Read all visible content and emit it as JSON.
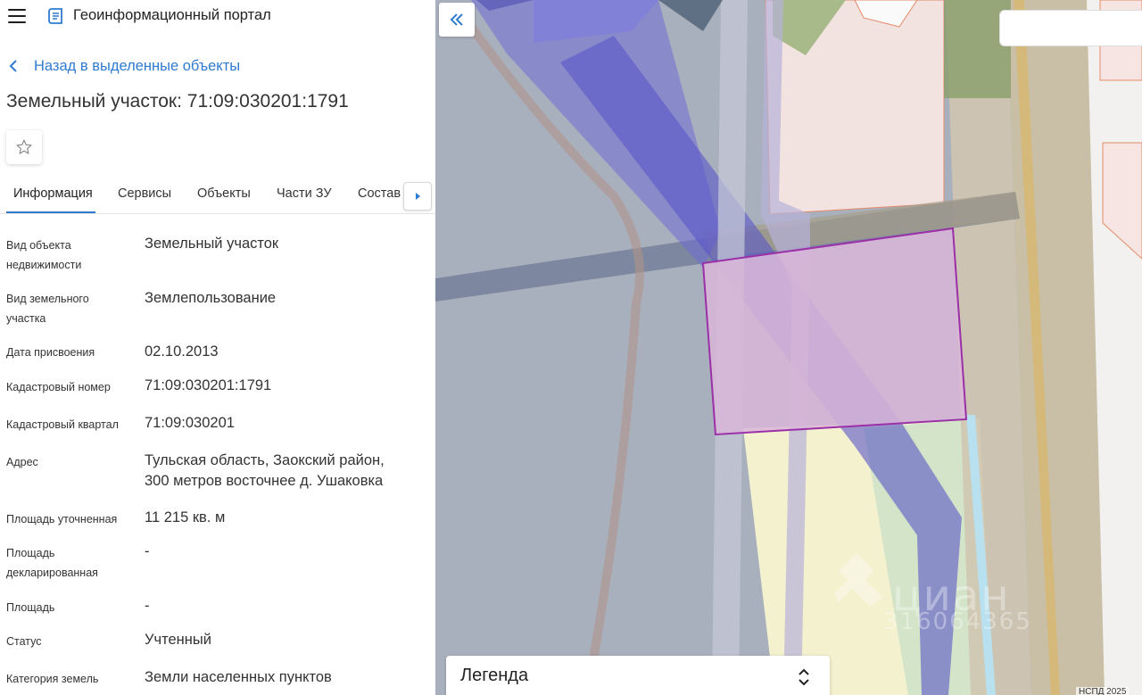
{
  "app": {
    "title": "Геоинформационный портал"
  },
  "nav": {
    "back_label": "Назад в выделенные объекты"
  },
  "object": {
    "title": "Земельный участок: 71:09:030201:1791"
  },
  "tabs": [
    {
      "label": "Информация",
      "active": true
    },
    {
      "label": "Сервисы"
    },
    {
      "label": "Объекты"
    },
    {
      "label": "Части ЗУ"
    },
    {
      "label": "Состав"
    }
  ],
  "info": [
    {
      "label": "Вид объекта недвижимости",
      "value": "Земельный участок"
    },
    {
      "label": "Вид земельного участка",
      "value": "Землепользование"
    },
    {
      "label": "Дата присвоения",
      "value": "02.10.2013"
    },
    {
      "label": "Кадастровый номер",
      "value": "71:09:030201:1791"
    },
    {
      "label": "Кадастровый квартал",
      "value": "71:09:030201"
    },
    {
      "label": "Адрес",
      "value": "Тульская область, Заокский район, 300 метров восточнее д. Ушаковка"
    },
    {
      "label": "Площадь уточненная",
      "value": "11 215 кв. м"
    },
    {
      "label": "Площадь декларированная",
      "value": "-"
    },
    {
      "label": "Площадь",
      "value": "-"
    },
    {
      "label": "Статус",
      "value": "Учтенный"
    },
    {
      "label": "Категория земель",
      "value": "Земли населенных пунктов"
    }
  ],
  "map": {
    "legend_title": "Легенда",
    "search_placeholder": "",
    "watermark_brand": "циан",
    "watermark_id": "316064365",
    "copyright": "НСПД 2025"
  },
  "colors": {
    "accent": "#2f7bd1",
    "parcel_fill": "#d9b6d8",
    "parcel_stroke": "#9b30a8",
    "zone_blue": "#6f6cd6",
    "road": "#c9bfa7"
  },
  "icons": {
    "menu": "hamburger-menu-icon",
    "logo": "portal-logo-icon",
    "back": "chevron-left-icon",
    "favorite": "star-outline-icon",
    "tabs_scroll": "caret-right-icon",
    "collapse": "double-chevron-left-icon",
    "legend_toggle": "chevron-up-down-icon"
  }
}
